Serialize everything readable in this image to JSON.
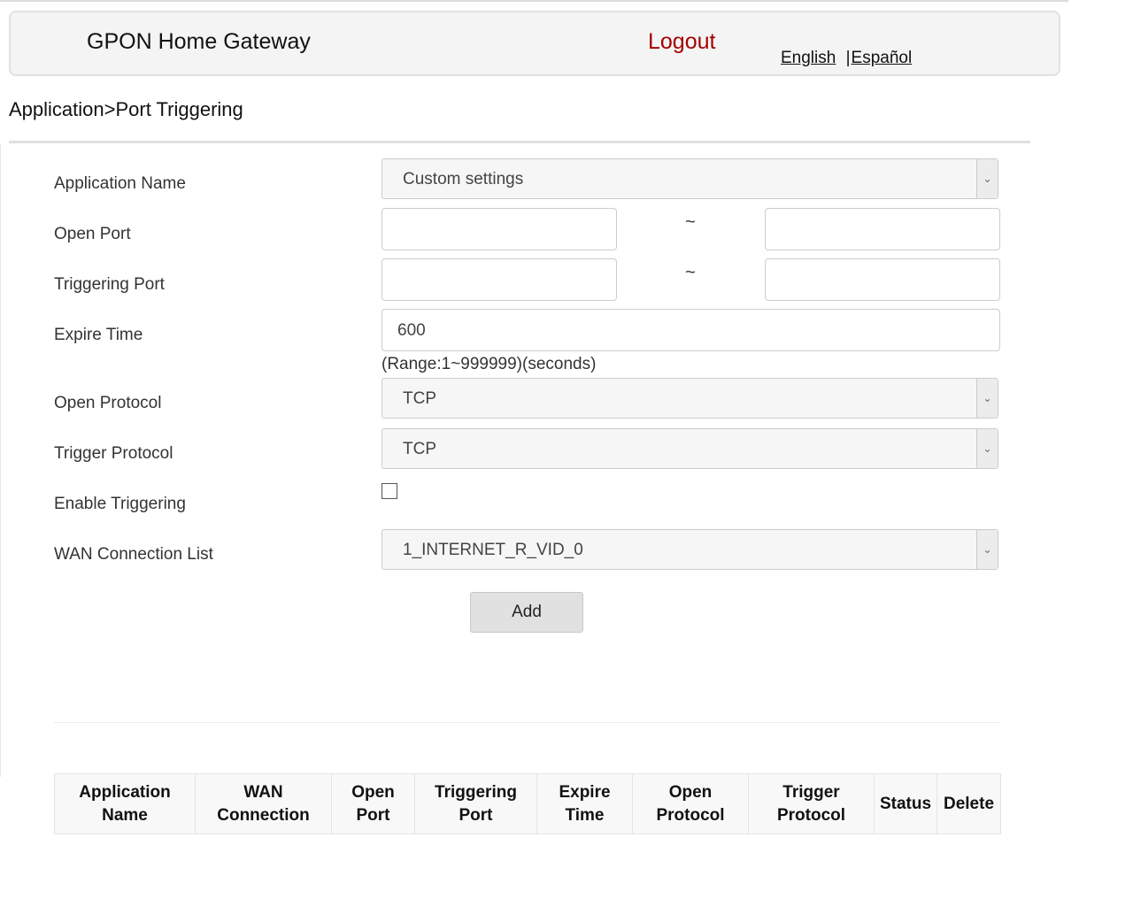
{
  "header": {
    "title": "GPON Home Gateway",
    "logout_label": "Logout",
    "languages": [
      "English",
      "Español"
    ],
    "language_separator": "|"
  },
  "breadcrumb": "Application>Port Triggering",
  "form": {
    "application_name": {
      "label": "Application Name",
      "value": "Custom settings"
    },
    "open_port": {
      "label": "Open Port",
      "start": "",
      "end": "",
      "separator": "~"
    },
    "triggering_port": {
      "label": "Triggering Port",
      "start": "",
      "end": "",
      "separator": "~"
    },
    "expire_time": {
      "label": "Expire Time",
      "value": "600",
      "hint": "(Range:1~999999)(seconds)"
    },
    "open_protocol": {
      "label": "Open Protocol",
      "value": "TCP"
    },
    "trigger_protocol": {
      "label": "Trigger Protocol",
      "value": "TCP"
    },
    "enable_triggering": {
      "label": "Enable Triggering",
      "checked": false
    },
    "wan_connection": {
      "label": "WAN Connection List",
      "value": "1_INTERNET_R_VID_0"
    },
    "add_label": "Add"
  },
  "table": {
    "headers": [
      [
        "Application",
        "Name"
      ],
      [
        "WAN",
        "Connection"
      ],
      [
        "Open",
        "Port"
      ],
      [
        "Triggering",
        "Port"
      ],
      [
        "Expire",
        "Time"
      ],
      [
        "Open",
        "Protocol"
      ],
      [
        "Trigger",
        "Protocol"
      ],
      [
        "Status",
        ""
      ],
      [
        "Delete",
        ""
      ]
    ],
    "rows": []
  },
  "icons": {
    "select_arrow": "chevron-down-icon",
    "autofill": "contact-card-icon"
  },
  "colors": {
    "logout": "#a30000",
    "header_bg": "#f4f4f4",
    "button_bg": "#e1e1e1"
  }
}
